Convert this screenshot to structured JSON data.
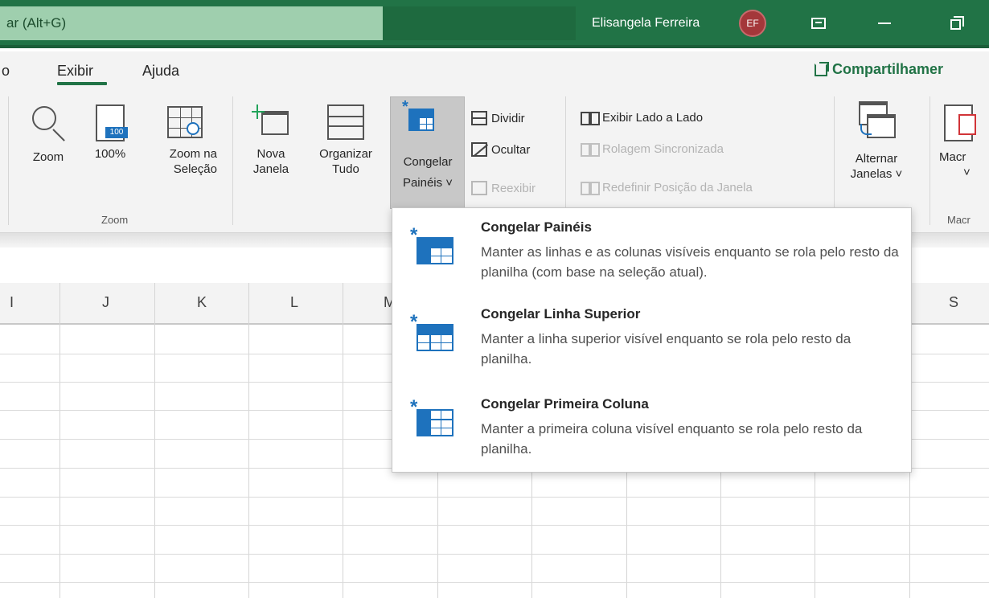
{
  "titlebar": {
    "search_text": "ar (Alt+G)",
    "user_name": "Elisangela Ferreira",
    "avatar_initials": "EF"
  },
  "tabs": {
    "partial_left": "o",
    "view": "Exibir",
    "help": "Ajuda",
    "share": "Compartilhamer"
  },
  "ribbon": {
    "zoom": "Zoom",
    "zoom100_label": "100%",
    "zoom100_badge": "100",
    "zoom_selection_line1": "Zoom na",
    "zoom_selection_line2": "Seleção",
    "zoom_group": "Zoom",
    "new_window_line1": "Nova",
    "new_window_line2": "Janela",
    "arrange_line1": "Organizar",
    "arrange_line2": "Tudo",
    "freeze_line1": "Congelar",
    "freeze_line2": "Painéis ˅",
    "split": "Dividir",
    "hide": "Ocultar",
    "unhide": "Reexibir",
    "side_by_side": "Exibir Lado a Lado",
    "sync_scroll": "Rolagem Sincronizada",
    "reset_position": "Redefinir Posição da Janela",
    "switch_line1": "Alternar",
    "switch_line2": "Janelas ˅",
    "macros": "Macr",
    "macros_arrow": "˅",
    "macros_group": "Macr"
  },
  "columns": [
    "I",
    "J",
    "K",
    "L",
    "M",
    "S"
  ],
  "dropdown": {
    "items": [
      {
        "title": "Congelar Painéis",
        "description": "Manter as linhas e as colunas visíveis enquanto se rola pelo resto da planilha (com base na seleção atual)."
      },
      {
        "title": "Congelar Linha Superior",
        "description": "Manter a linha superior visível enquanto se rola pelo resto da planilha."
      },
      {
        "title": "Congelar Primeira Coluna",
        "description": "Manter a primeira coluna visível enquanto se rola pelo resto da planilha."
      }
    ]
  },
  "colors": {
    "excel_green": "#217346",
    "accent_blue": "#1e72bd",
    "avatar_red": "#a4373a"
  }
}
